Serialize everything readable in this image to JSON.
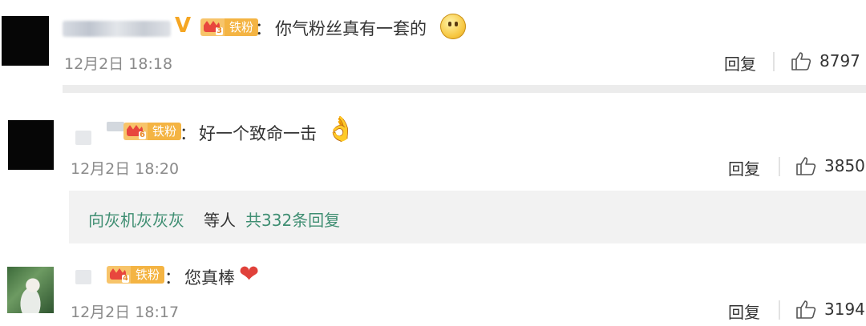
{
  "comments": [
    {
      "fan_level": "3",
      "fan_label": "铁粉",
      "verified_badge": "V",
      "separator": "：",
      "text": "你气粉丝真有一套的",
      "emoji": "smile-emoji",
      "time": "12月2日 18:18",
      "reply_label": "回复",
      "likes": "8797"
    },
    {
      "fan_level": "6",
      "fan_label": "铁粉",
      "separator": "：",
      "text": "好一个致命一击",
      "emoji": "ok-hand-emoji",
      "time": "12月2日 18:20",
      "reply_label": "回复",
      "likes": "3850",
      "subreplies": {
        "user": "向灰机灰灰灰",
        "middle": "等人",
        "count_text": "共332条回复"
      }
    },
    {
      "fan_level": "4",
      "fan_label": "铁粉",
      "separator": "：",
      "text": "您真棒",
      "emoji": "heart-emoji",
      "time": "12月2日 18:17",
      "reply_label": "回复",
      "likes": "3194"
    }
  ],
  "icons": {
    "like": "thumbs-up-icon"
  },
  "colors": {
    "verified": "#f5a623",
    "fan_badge": "#f4b443",
    "link_green": "#3f8e72",
    "heart": "#e0413a"
  }
}
